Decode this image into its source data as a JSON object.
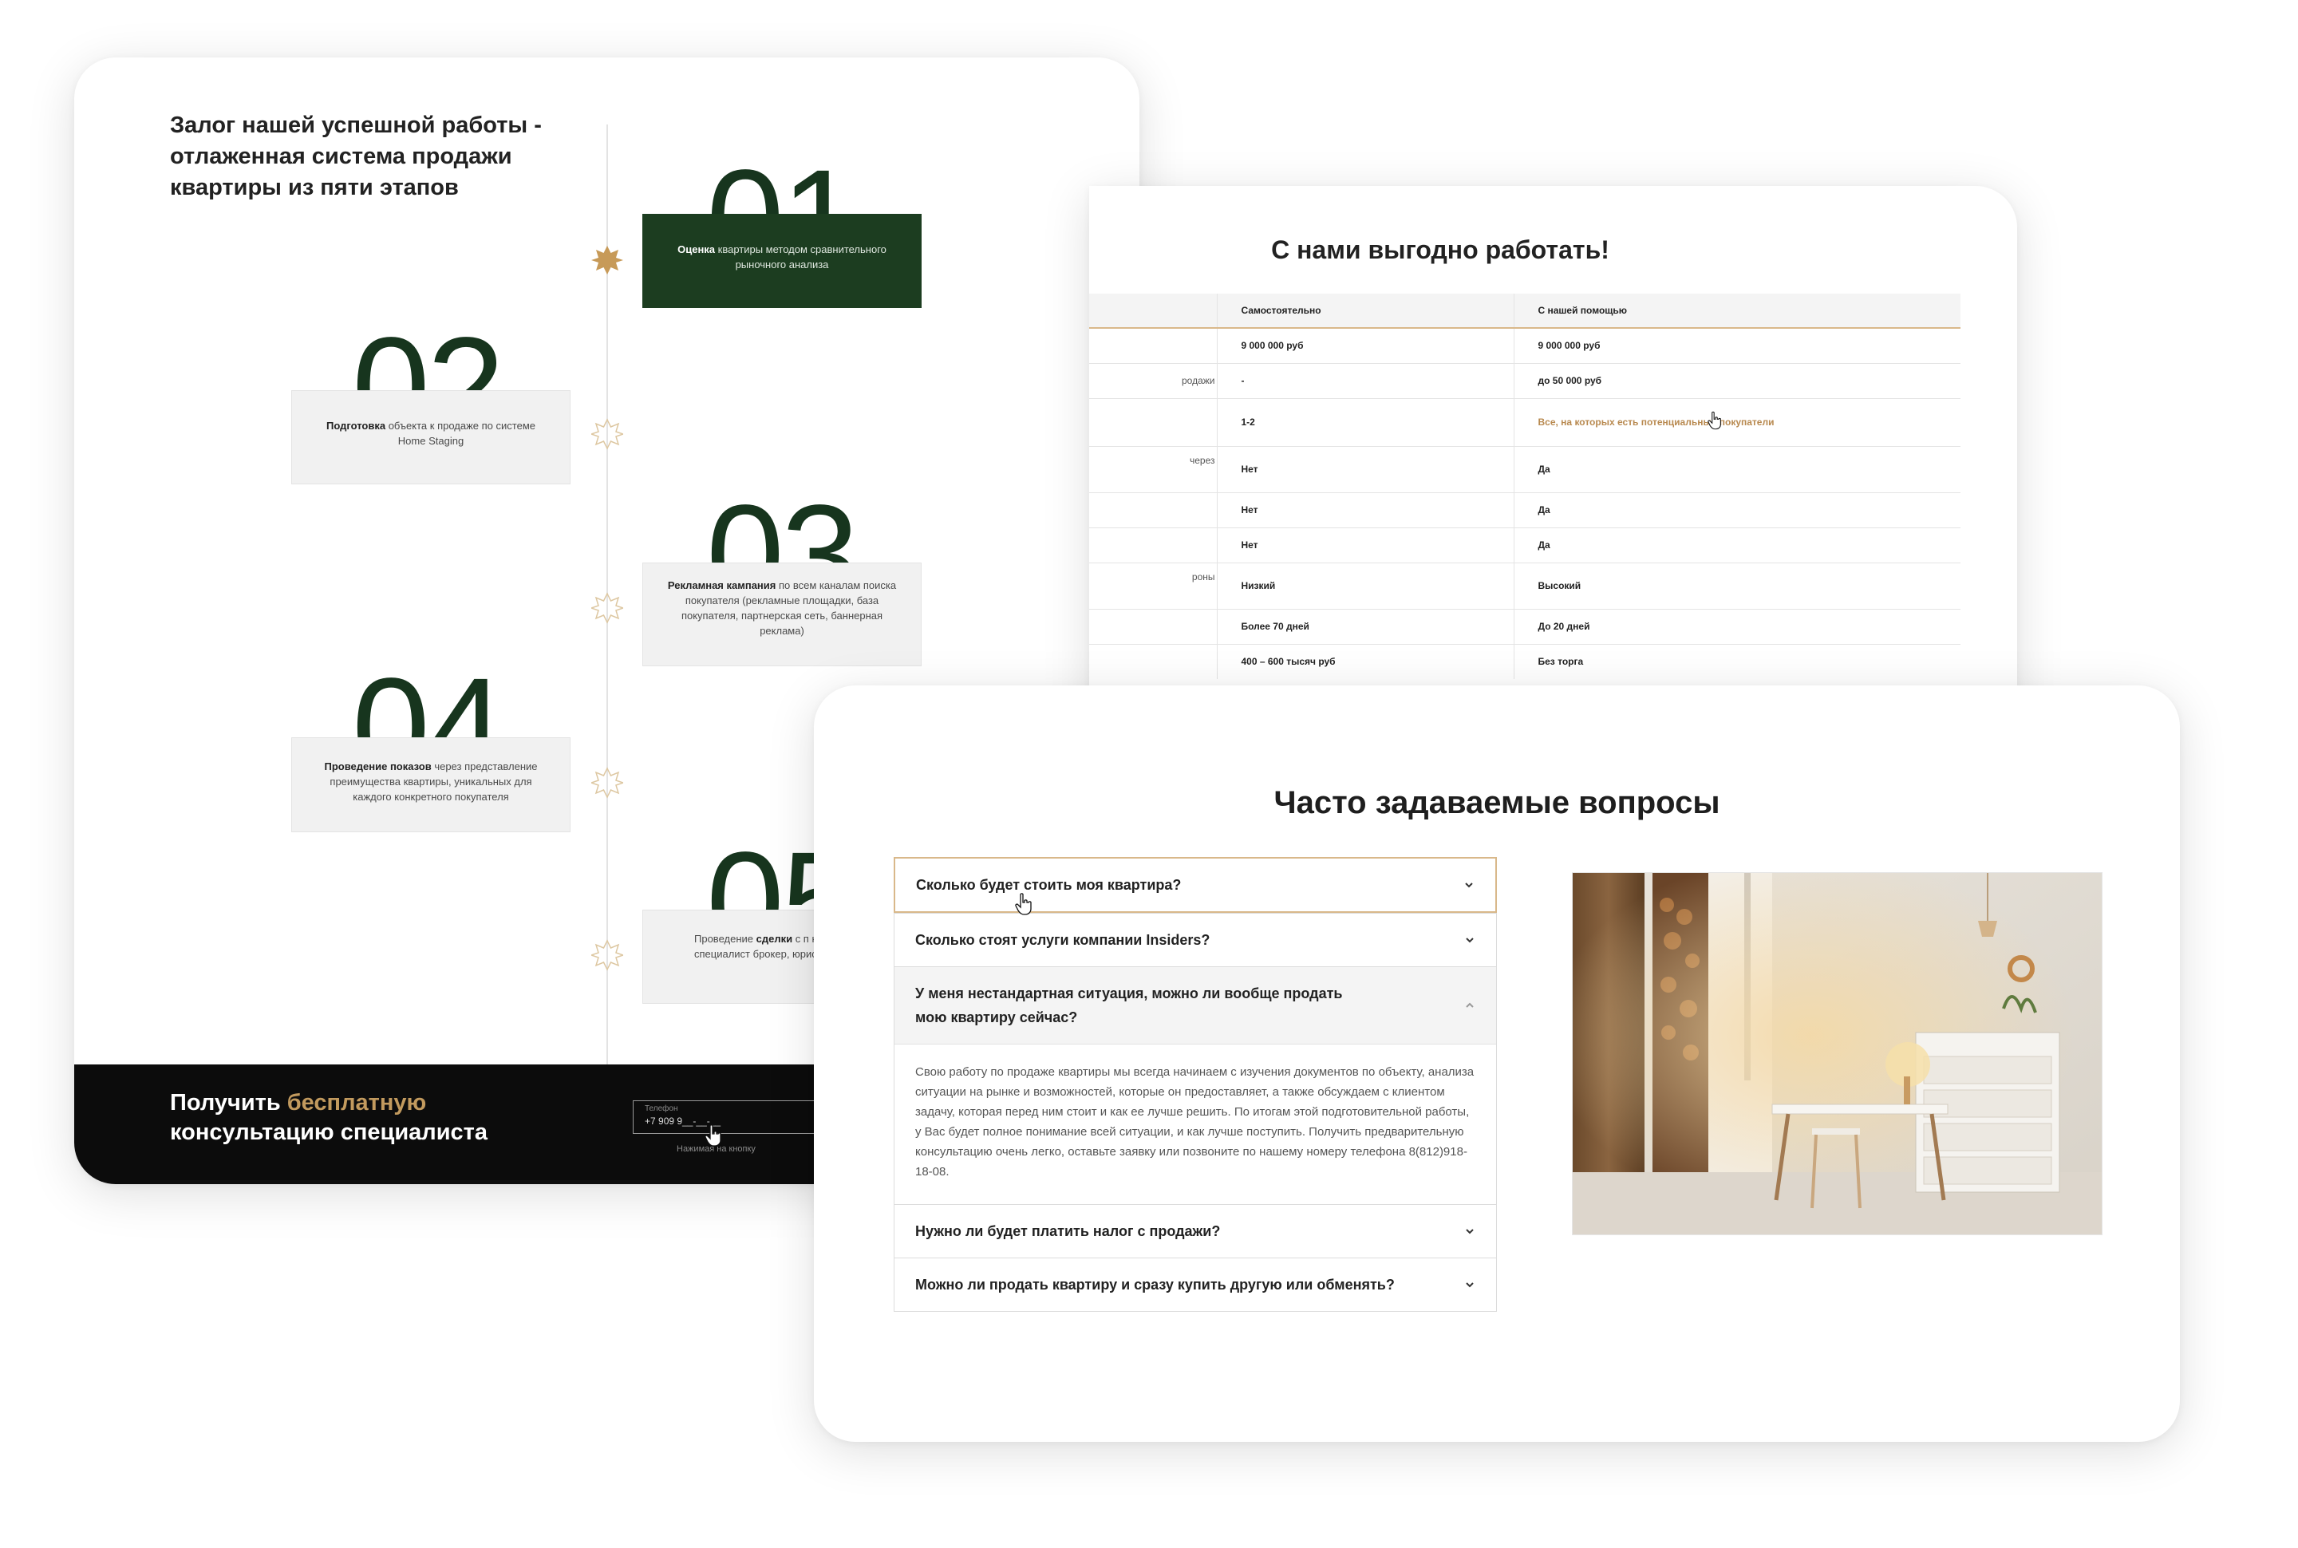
{
  "stages_card": {
    "heading": "Залог нашей успешной работы - отлаженная система продажи квартиры из пяти этапов",
    "stages": [
      {
        "number": "01",
        "bold": "Оценка",
        "text": " квартиры методом сравнительного рыночного анализа",
        "highlighted": true
      },
      {
        "number": "02",
        "bold": "Подготовка",
        "text": " объекта к продаже по системе Home Staging",
        "highlighted": false
      },
      {
        "number": "03",
        "bold": "Рекламная кампания",
        "text": " по всем каналам поиска покупателя (рекламные площадки, база покупателя, партнерская сеть, баннерная реклама)",
        "highlighted": false
      },
      {
        "number": "04",
        "bold": "Проведение показов",
        "text": " через представление преимущества квартиры, уникальных для каждого конкретного покупателя",
        "highlighted": false
      },
      {
        "number": "05",
        "pre": "Проведение ",
        "bold": "сделки",
        "text": " с п необходимых специалист брокер, юрист, нотариус",
        "highlighted": false
      }
    ],
    "cta": {
      "title_prefix": "Получить ",
      "title_accent": "бесплатную",
      "title_suffix": " консультацию специалиста",
      "phone_label": "Телефон",
      "phone_value": "+7 909 9__-__-__",
      "note": "Нажимая на кнопку"
    },
    "colors": {
      "dark_green": "#1c3d20",
      "gold": "#c29a5e",
      "black": "#0c0c0c"
    }
  },
  "compare_card": {
    "title": "С нами выгодно работать!",
    "headers": [
      "",
      "Самостоятельно",
      "С нашей помощью"
    ],
    "rows": [
      [
        "",
        "9 000 000 руб",
        "9 000 000 руб"
      ],
      [
        "родажи",
        "-",
        "до 50 000 руб"
      ],
      [
        "",
        "1-2",
        "Все, на которых есть потенциальные покупатели"
      ],
      [
        "через",
        "Нет",
        "Да"
      ],
      [
        "",
        "Нет",
        "Да"
      ],
      [
        "",
        "Нет",
        "Да"
      ],
      [
        "роны",
        "Низкий",
        "Высокий"
      ],
      [
        "",
        "Более 70 дней",
        "До 20 дней"
      ],
      [
        "",
        "400 – 600 тысяч руб",
        "Без торга"
      ]
    ]
  },
  "faq_card": {
    "title": "Часто задаваемые вопросы",
    "items": [
      {
        "question": "Сколько будет стоить моя квартира?",
        "state": "hover",
        "icon": "chevron-down-icon"
      },
      {
        "question": "Сколько стоят услуги компании Insiders?",
        "state": "closed",
        "icon": "chevron-down-icon"
      },
      {
        "question": "У меня нестандартная ситуация, можно ли вообще продать мою квартиру сейчас?",
        "state": "open",
        "icon": "chevron-up-icon",
        "answer": "Свою работу по продаже квартиры мы всегда начинаем с изучения документов по объекту, анализа ситуации на рынке и возможностей, которые он предоставляет, а также обсуждаем с клиентом задачу, которая перед ним стоит и как ее лучше решить. По итогам этой подготовительной работы, у Вас будет полное понимание всей ситуации, и как лучше поступить. Получить предварительную консультацию очень легко, оставьте заявку или позвоните по нашему номеру телефона 8(812)918-18-08."
      },
      {
        "question": "Нужно ли будет платить налог с продажи?",
        "state": "closed",
        "icon": "chevron-down-icon"
      },
      {
        "question": "Можно ли продать квартиру и сразу купить другую или обменять?",
        "state": "closed",
        "icon": "chevron-down-icon"
      }
    ]
  }
}
